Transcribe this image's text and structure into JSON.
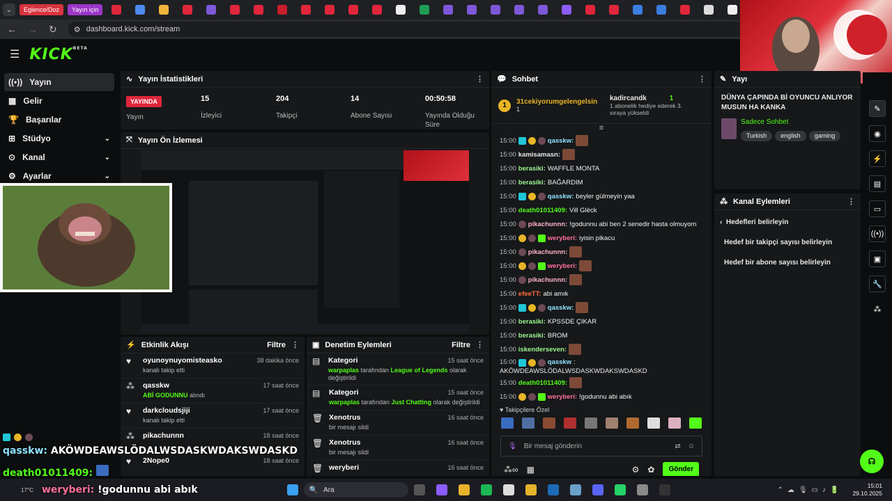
{
  "browser": {
    "tabs": {
      "pill1": "Eglence/Doz",
      "pill2": "Yayın için"
    },
    "url": "dashboard.kick.com/stream"
  },
  "colors": {
    "brand": "#53fc18",
    "live": "#e0263b",
    "panel": "#16181a",
    "background": "#0b0d0e"
  },
  "logo": {
    "text": "KICK",
    "sup": "BETA"
  },
  "sidebar": {
    "items": [
      {
        "label": "Yayın",
        "icon": "broadcast-icon"
      },
      {
        "label": "Gelir",
        "icon": "income-icon"
      },
      {
        "label": "Başarılar",
        "icon": "trophy-icon"
      },
      {
        "label": "Stüdyo",
        "icon": "studio-icon"
      },
      {
        "label": "Kanal",
        "icon": "channel-icon"
      },
      {
        "label": "Ayarlar",
        "icon": "gear-icon"
      }
    ]
  },
  "stats": {
    "title": "Yayın İstatistikleri",
    "live_label": "YAYINDA",
    "live_sub": "Yayın",
    "viewers": "15",
    "viewers_label": "İzleyici",
    "followers": "204",
    "followers_label": "Takipçi",
    "subs": "14",
    "subs_label": "Abone Sayısı",
    "duration": "00:50:58",
    "duration_label": "Yayında Olduğu Süre"
  },
  "preview": {
    "title": "Yayın Ön İzlemesi"
  },
  "activity": {
    "title": "Etkinlik Akışı",
    "filter": "Filtre",
    "items": [
      {
        "name": "oyunoynuyomisteasko",
        "sub": "kanalı takip etti",
        "time": "38 dakika önce"
      },
      {
        "name": "qasskw",
        "sub_green": "ABİ GODUNNU",
        "sub": " alındı",
        "time": "17 saat önce"
      },
      {
        "name": "darkcloudsjiji",
        "sub": "kanalı takip etti",
        "time": "17 saat önce"
      },
      {
        "name": "pikachunnn",
        "sub": "",
        "time": "18 saat önce"
      },
      {
        "name": "2Nope0",
        "sub": "",
        "time": "18 saat önce"
      }
    ]
  },
  "moderation": {
    "title": "Denetim Eylemleri",
    "filter": "Filtre",
    "items": [
      {
        "name": "Kategori",
        "user": "warpaplas",
        "mid": " tarafından ",
        "target": "League of Legends",
        "end": " olarak değiştirildi",
        "time": "15 saat önce"
      },
      {
        "name": "Kategori",
        "user": "warpaplas",
        "mid": " tarafından ",
        "target": "Just Chatting",
        "end": " olarak değiştirildi",
        "time": "15 saat önce"
      },
      {
        "name": "Xenotrus",
        "sub": "bir mesajı sildi",
        "time": "16 saat önce"
      },
      {
        "name": "Xenotrus",
        "sub": "bir mesajı sildi",
        "time": "16 saat önce"
      },
      {
        "name": "weryberi",
        "sub": "",
        "time": "16 saat önce"
      }
    ]
  },
  "chat": {
    "title": "Sohbet",
    "top_gifter": "31cekiyorumgelengelsin",
    "top_gifter_count": "1",
    "gift_user": "kadircandk",
    "gift_count": "1",
    "gift_text": "1 abonelik hediye ederek 3. sıraya yükseldi",
    "messages": [
      {
        "time": "15:00",
        "user": "qasskw",
        "color": "#8fe3ff",
        "text": "",
        "badges": [
          "sub",
          "gold",
          "av"
        ],
        "emote": true
      },
      {
        "time": "15:00",
        "user": "kamisamasn",
        "color": "#e8e8e8",
        "text": "",
        "badges": [],
        "emote": true
      },
      {
        "time": "15:00",
        "user": "berasiki",
        "color": "#9cf78f",
        "text": "WAFFLE MONTA",
        "badges": []
      },
      {
        "time": "15:00",
        "user": "berasiki",
        "color": "#9cf78f",
        "text": "BAĞARDIM",
        "badges": []
      },
      {
        "time": "15:00",
        "user": "qasskw",
        "color": "#8fe3ff",
        "text": "beyler gülmeyin yaa",
        "badges": [
          "sub",
          "gold",
          "av"
        ]
      },
      {
        "time": "15:00",
        "user": "death01011409",
        "color": "#53fc18",
        "text": "Vill Gléck",
        "badges": []
      },
      {
        "time": "15:00",
        "user": "pikachunnn",
        "color": "#ffb0c8",
        "text": "!godunnu abi ben 2 senedir hasta olmuyom",
        "badges": [
          "av"
        ]
      },
      {
        "time": "15:00",
        "user": "weryberi",
        "color": "#ff6f9a",
        "text": "iyisin pikacu",
        "badges": [
          "gold",
          "av",
          "g"
        ]
      },
      {
        "time": "15:00",
        "user": "pikachunnn",
        "color": "#ffb0c8",
        "text": "",
        "badges": [
          "av"
        ],
        "emote": true
      },
      {
        "time": "15:00",
        "user": "weryberi",
        "color": "#ff6f9a",
        "text": "",
        "badges": [
          "gold",
          "av",
          "g"
        ],
        "emote": true
      },
      {
        "time": "15:00",
        "user": "pikachunnn",
        "color": "#ffb0c8",
        "text": "",
        "badges": [
          "av"
        ],
        "emote": true
      },
      {
        "time": "15:00",
        "user": "efeeTT",
        "color": "#ff6a3d",
        "text": "abi amık",
        "badges": []
      },
      {
        "time": "15:00",
        "user": "qasskw",
        "color": "#8fe3ff",
        "text": "",
        "badges": [
          "sub",
          "gold",
          "av"
        ],
        "emote": true
      },
      {
        "time": "15:00",
        "user": "berasiki",
        "color": "#9cf78f",
        "text": "KPSSDE ÇIKAR",
        "badges": []
      },
      {
        "time": "15:00",
        "user": "berasiki",
        "color": "#9cf78f",
        "text": "BROM",
        "badges": []
      },
      {
        "time": "15:00",
        "user": "iskenderseven",
        "color": "#9cf78f",
        "text": "",
        "badges": [],
        "emote": true
      }
    ],
    "long_user": "qasskw",
    "long_text": "AKÖWDEAWSLÖDALWSDASKWDAKSWDASKD",
    "tail": [
      {
        "time": "15:00",
        "user": "death01011409",
        "color": "#53fc18",
        "text": "",
        "badges": [],
        "emote": true
      },
      {
        "time": "15:00",
        "user": "weryberi",
        "color": "#ff6f9a",
        "text": "!godunnu abi abık",
        "badges": [
          "gold",
          "av",
          "g"
        ]
      }
    ],
    "follower_only": "Takipçilere Özel",
    "placeholder": "Bir mesaj gönderin",
    "send": "Gönder"
  },
  "right": {
    "header": "Yayı",
    "title": "DÜNYA ÇAPINDA Bİ OYUNCU ANLIYOR MUSUN HA KANKA",
    "chat_mode": "Sadece Sohbet",
    "tags": [
      "Turkish",
      "english",
      "gaming"
    ],
    "actions_title": "Kanal Eylemleri",
    "goals_title": "Hedefleri belirleyin",
    "goal1": "Hedef bir takipçi sayısı belirleyin",
    "goal2": "Hedef bir abone sayısı belirleyin"
  },
  "overlay": {
    "line1_user": "qasskw:",
    "line1_text": " AKÖWDEAWSLÖDALWSDASKWDAKSWDASKD",
    "line2_user": "death01011409:",
    "line3_user": "weryberi:",
    "line3_text": " !godunnu abi abık",
    "line3_prefix": "17°C"
  },
  "taskbar": {
    "search": "Ara",
    "time": "15:01",
    "date": "29.10.2025"
  }
}
